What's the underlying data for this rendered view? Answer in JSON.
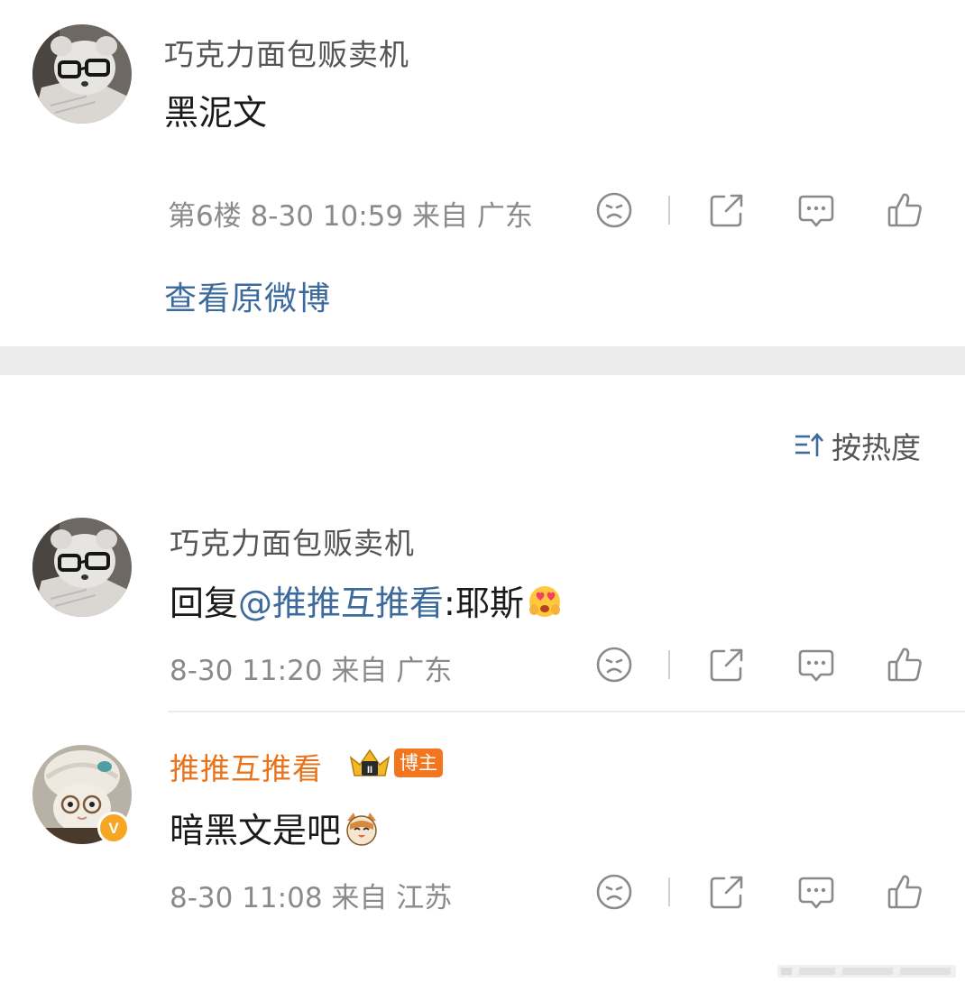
{
  "post": {
    "username": "巧克力面包贩卖机",
    "content": "黑泥文",
    "meta": "第6楼 8-30 10:59 来自 广东",
    "view_original": "查看原微博"
  },
  "sort": {
    "label": "按热度",
    "icon": "sort-icon"
  },
  "comments": [
    {
      "username": "巧克力面包贩卖机",
      "reply_prefix": "回复",
      "mention": "@推推互推看",
      "content": ":耶斯",
      "emoji": "heart-eyes-emoji",
      "meta": "8-30 11:20 来自 广东"
    },
    {
      "username": "推推互推看",
      "badge_author": "博主",
      "crown_level": "II",
      "content": "暗黑文是吧",
      "emoji": "cat-emoji",
      "meta": "8-30 11:08 来自 江苏",
      "verified_letter": "V"
    }
  ],
  "actions": [
    "dislike-icon",
    "share-icon",
    "comment-icon",
    "like-icon"
  ],
  "colors": {
    "link": "#3d6a9c",
    "author_orange": "#e8731a",
    "meta_gray": "#8a8a8a",
    "badge_orange": "#f2761d"
  }
}
